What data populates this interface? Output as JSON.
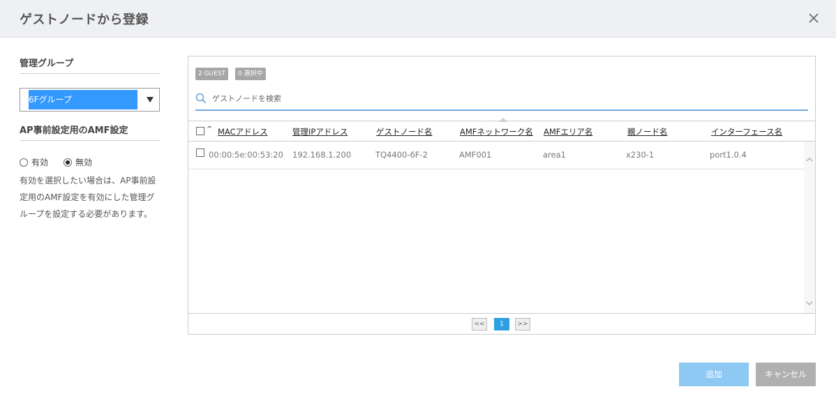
{
  "dialog": {
    "title": "ゲストノードから登録",
    "close_icon": "close-icon"
  },
  "left": {
    "group_title": "管理グループ",
    "group_selected": "6Fグループ",
    "amf_title": "AP事前設定用のAMF設定",
    "radio_enable": "有効",
    "radio_disable": "無効",
    "radio_selected": "無効",
    "note": "有効を選択したい場合は、AP事前設定用のAMF設定を有効にした管理グループを設定する必要があります。"
  },
  "panel": {
    "badge_guest": "2 GUEST",
    "badge_selected": "0 選択中",
    "search_placeholder": "ゲストノードを検索",
    "columns": [
      "MACアドレス",
      "管理IPアドレス",
      "ゲストノード名",
      "AMFネットワーク名",
      "AMFエリア名",
      "親ノード名",
      "インターフェース名"
    ],
    "sort_mark": "^",
    "rows": [
      [
        "00:00:5e:00:53:20",
        "192.168.1.200",
        "TQ4400-6F-2",
        "AMF001",
        "area1",
        "x230-1",
        "port1.0.4"
      ]
    ],
    "pager": {
      "first": "<<",
      "page": "1",
      "last": ">>"
    }
  },
  "buttons": {
    "add": "追加",
    "cancel": "キャンセル"
  },
  "colors": {
    "accent": "#2e9fe0",
    "add_button": "#8ec9f4",
    "cancel_button": "#b0b0b0",
    "selection": "#3399ff"
  }
}
